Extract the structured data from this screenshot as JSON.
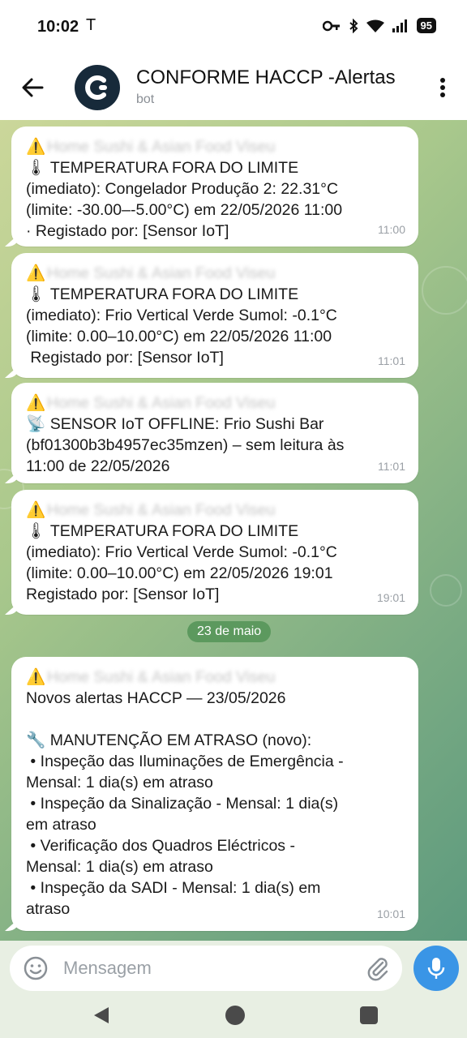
{
  "status_bar": {
    "time": "10:02",
    "carrier_icon": "T",
    "battery": "95"
  },
  "header": {
    "title": "CONFORME HACCP -Alertas",
    "subtitle": "bot"
  },
  "messages": [
    {
      "warning_icon": "⚠️",
      "sender_blurred": "Home Sushi & Asian Food Viseu",
      "lines": [
        "🌡 TEMPERATURA FORA DO LIMITE",
        "(imediato): Congelador Produção 2: 22.31°C",
        "(limite: -30.00–-5.00°C) em 22/05/2026 11:00",
        "· Registado por: [Sensor IoT]"
      ],
      "time": "11:00"
    },
    {
      "warning_icon": "⚠️",
      "sender_blurred": "Home Sushi & Asian Food Viseu",
      "lines": [
        "🌡 TEMPERATURA FORA DO LIMITE",
        "(imediato): Frio Vertical Verde Sumol: -0.1°C",
        "(limite: 0.00–10.00°C) em 22/05/2026 11:00",
        " Registado por: [Sensor IoT]"
      ],
      "time": "11:01"
    },
    {
      "warning_icon": "⚠️",
      "sender_blurred": "Home Sushi & Asian Food Viseu",
      "lines": [
        "📡 SENSOR IoT OFFLINE: Frio Sushi Bar",
        "(bf01300b3b4957ec35mzen) – sem leitura às",
        "11:00 de 22/05/2026"
      ],
      "time": "11:01"
    },
    {
      "warning_icon": "⚠️",
      "sender_blurred": "Home Sushi & Asian Food Viseu",
      "lines": [
        "🌡 TEMPERATURA FORA DO LIMITE",
        "(imediato): Frio Vertical Verde Sumol: -0.1°C",
        "(limite: 0.00–10.00°C) em 22/05/2026 19:01",
        "Registado por: [Sensor IoT]"
      ],
      "time": "19:01"
    },
    {
      "warning_icon": "⚠️",
      "sender_blurred": "Home Sushi & Asian Food Viseu",
      "lines": [
        "Novos alertas HACCP — 23/05/2026",
        "",
        "🔧 MANUTENÇÃO EM ATRASO (novo):",
        " • Inspeção das Iluminações de Emergência -",
        "Mensal: 1 dia(s) em atraso",
        " • Inspeção da Sinalização - Mensal: 1 dia(s)",
        "em atraso",
        " • Verificação dos Quadros Eléctricos -",
        "Mensal: 1 dia(s) em atraso",
        " • Inspeção da SADI - Mensal: 1 dia(s) em",
        "atraso"
      ],
      "time": "10:01"
    }
  ],
  "date_separator": "23 de maio",
  "composer": {
    "placeholder": "Mensagem"
  },
  "icons": {
    "back": "arrow-left-icon",
    "menu": "more-vert-icon",
    "emoji": "smiley-icon",
    "attach": "paperclip-icon",
    "mic": "microphone-icon"
  },
  "colors": {
    "mic_button": "#3a95e6",
    "date_pill": "#57965a",
    "avatar_bg": "#172a3a"
  }
}
